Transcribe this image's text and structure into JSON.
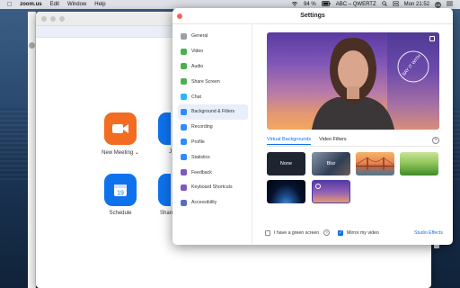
{
  "menubar": {
    "apple": "",
    "app": "zoom.us",
    "items": [
      "Edit",
      "Window",
      "Help"
    ],
    "battery": "94 %",
    "input_source": "ABC – QWERTZ",
    "clock": "Mon 21:52",
    "user_badge": "LB"
  },
  "home": {
    "tiles": [
      {
        "label": "New Meeting",
        "chevron": "⌄"
      },
      {
        "label": "Schedule",
        "day": "19"
      }
    ],
    "partial_labels": [
      "J",
      "Share"
    ]
  },
  "settings": {
    "title": "Settings",
    "nav": [
      {
        "label": "General",
        "icon": "gear-icon",
        "color": "#9aa0a6"
      },
      {
        "label": "Video",
        "icon": "video-icon",
        "color": "#4caf50"
      },
      {
        "label": "Audio",
        "icon": "headphones-icon",
        "color": "#4caf50"
      },
      {
        "label": "Share Screen",
        "icon": "share-screen-icon",
        "color": "#4caf50"
      },
      {
        "label": "Chat",
        "icon": "chat-icon",
        "color": "#29b6f6"
      },
      {
        "label": "Background & Filters",
        "icon": "background-icon",
        "color": "#2d8cff",
        "active": true
      },
      {
        "label": "Recording",
        "icon": "recording-icon",
        "color": "#2d8cff"
      },
      {
        "label": "Profile",
        "icon": "profile-icon",
        "color": "#2d8cff"
      },
      {
        "label": "Statistics",
        "icon": "statistics-icon",
        "color": "#2d8cff"
      },
      {
        "label": "Feedback",
        "icon": "feedback-icon",
        "color": "#7e57c2"
      },
      {
        "label": "Keyboard Shortcuts",
        "icon": "keyboard-icon",
        "color": "#7e57c2"
      },
      {
        "label": "Accessibility",
        "icon": "accessibility-icon",
        "color": "#5c6bc0"
      }
    ],
    "preview_watermark": "SAY IT WITH",
    "tabs": [
      "Virtual Backgrounds",
      "Video Filters"
    ],
    "add_label": "+",
    "backgrounds": [
      {
        "label": "None",
        "kind": "none"
      },
      {
        "label": "Blur",
        "kind": "blur"
      },
      {
        "label": "",
        "kind": "bridge"
      },
      {
        "label": "",
        "kind": "grass"
      },
      {
        "label": "",
        "kind": "earth"
      },
      {
        "label": "",
        "kind": "custom",
        "selected": true
      }
    ],
    "green_screen_label": "I have a green screen",
    "green_screen_checked": false,
    "mirror_label": "Mirror my video",
    "mirror_checked": true,
    "studio_effects": "Studio Effects",
    "accent": "#0e72ed"
  }
}
